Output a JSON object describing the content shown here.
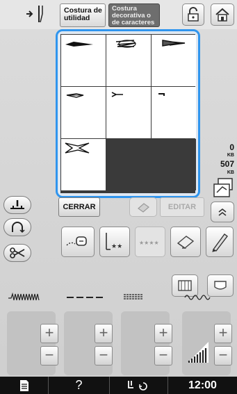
{
  "topbar": {
    "tab_utility_label": "Costura de\nutilidad",
    "tab_decorative_label": "Costura\ndecorativa o\nde caracteres"
  },
  "grid": {
    "cells": [
      {
        "stitch": "satin-pointed"
      },
      {
        "stitch": "zigzag-loop"
      },
      {
        "stitch": "double-pointed"
      },
      {
        "stitch": "arrow-outline"
      },
      {
        "stitch": "small-arrow"
      },
      {
        "stitch": "tick"
      },
      {
        "stitch": "fishtail"
      }
    ]
  },
  "memory": {
    "used_value": "0",
    "used_unit": "KB",
    "free_value": "507",
    "free_unit": "KB"
  },
  "actions": {
    "close_label": "CERRAR",
    "edit_label": "EDITAR"
  },
  "adjust": {
    "labels": [
      "width",
      "length",
      "tension",
      "density"
    ]
  },
  "bottombar": {
    "help_label": "?",
    "clock": "12:00"
  },
  "colors": {
    "selection_border": "#2f95ee",
    "bottombar": "#111111"
  }
}
